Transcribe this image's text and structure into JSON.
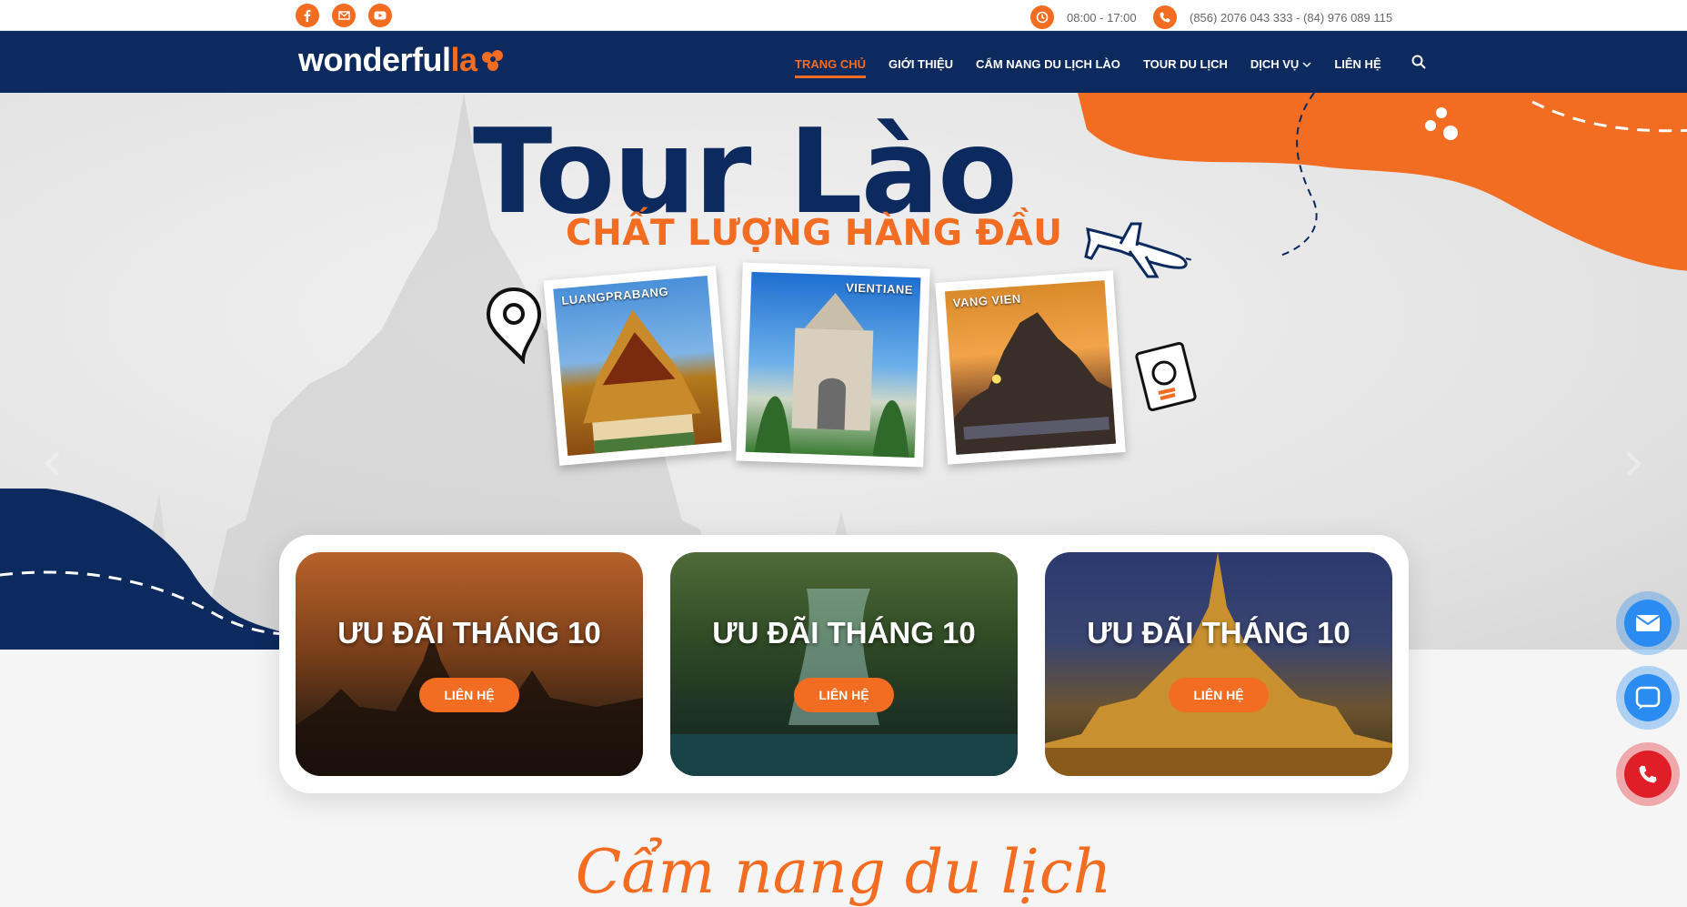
{
  "topbar": {
    "hours": "08:00 - 17:00",
    "phones": "(856) 2076 043 333 - (84) 976 089 115"
  },
  "brand": {
    "logo_part1": "wonderful",
    "logo_part2": "la"
  },
  "nav": {
    "items": [
      "TRANG CHỦ",
      "GIỚI THIỆU",
      "CẨM NANG DU LỊCH LÀO",
      "TOUR DU LỊCH",
      "DỊCH VỤ",
      "LIÊN HỆ"
    ]
  },
  "hero": {
    "title": "Tour Lào",
    "subtitle": "CHẤT LƯỢNG HÀNG ĐẦU",
    "photos": [
      "LUANGPRABANG",
      "VIENTIANE",
      "VANG VIEN"
    ]
  },
  "promos": [
    {
      "title": "ƯU ĐÃI THÁNG 10",
      "button": "LIÊN HỆ"
    },
    {
      "title": "ƯU ĐÃI THÁNG 10",
      "button": "LIÊN HỆ"
    },
    {
      "title": "ƯU ĐÃI THÁNG 10",
      "button": "LIÊN HỆ"
    }
  ],
  "section": {
    "title": "Cẩm nang du lịch"
  },
  "colors": {
    "brand_orange": "#f26c21",
    "brand_navy": "#0d2a5f"
  },
  "icons": {
    "social": [
      "facebook-icon",
      "email-icon",
      "youtube-icon"
    ],
    "floating": [
      "email-icon",
      "zalo-icon",
      "phone-icon"
    ]
  }
}
